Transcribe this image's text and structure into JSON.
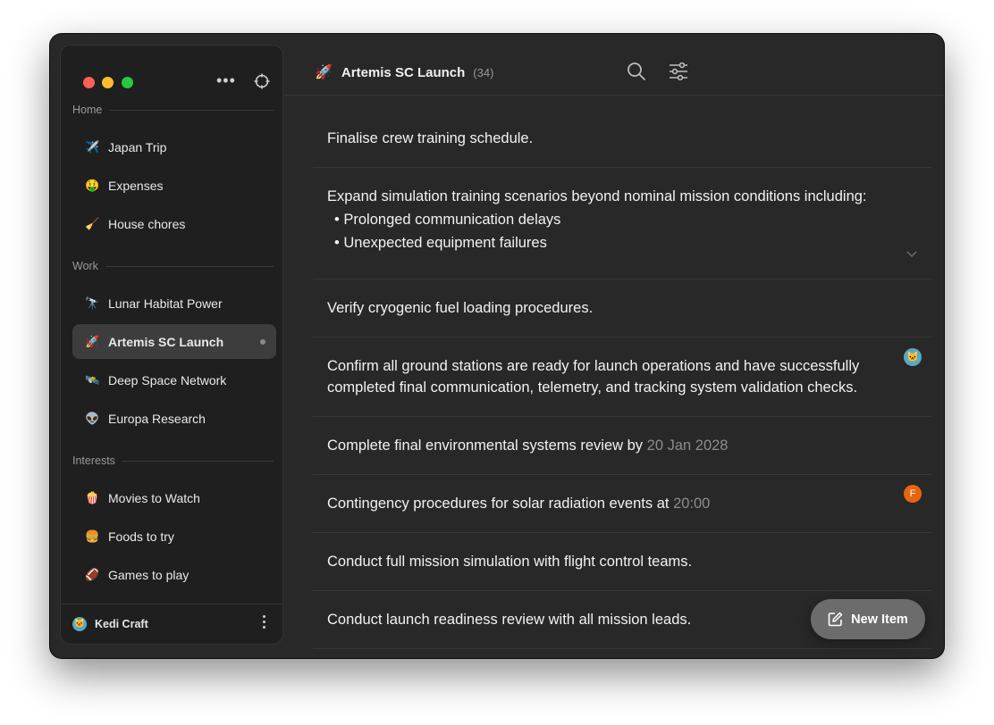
{
  "app": {
    "more_icon": "ellipsis-icon",
    "target_icon": "crosshair-icon"
  },
  "sidebar": {
    "sections": [
      {
        "label": "Home",
        "items": [
          {
            "emoji": "✈️",
            "label": "Japan Trip"
          },
          {
            "emoji": "🤑",
            "label": "Expenses"
          },
          {
            "emoji": "🧹",
            "label": "House chores"
          }
        ]
      },
      {
        "label": "Work",
        "items": [
          {
            "emoji": "🔭",
            "label": "Lunar Habitat Power"
          },
          {
            "emoji": "🚀",
            "label": "Artemis SC Launch",
            "active": true
          },
          {
            "emoji": "🛰️",
            "label": "Deep Space Network"
          },
          {
            "emoji": "👽",
            "label": "Europa Research"
          }
        ]
      },
      {
        "label": "Interests",
        "items": [
          {
            "emoji": "🍿",
            "label": "Movies to Watch"
          },
          {
            "emoji": "🍔",
            "label": "Foods to try"
          },
          {
            "emoji": "🏈",
            "label": "Games to play"
          }
        ]
      }
    ],
    "footer": {
      "avatar": "🐱",
      "name": "Kedi Craft"
    }
  },
  "header": {
    "emoji": "🚀",
    "title": "Artemis SC Launch",
    "count": "(34)",
    "search_icon": "search-icon",
    "filter_icon": "sliders-icon"
  },
  "items": [
    {
      "text": "Finalise crew training schedule."
    },
    {
      "text": "Expand simulation training scenarios beyond nominal mission conditions including:",
      "bullets": [
        "Prolonged communication delays",
        "Unexpected equipment failures"
      ]
    },
    {
      "text": "Verify cryogenic fuel loading procedures."
    },
    {
      "text": "Confirm all ground stations are ready for launch operations and have successfully",
      "text2": "completed final communication, telemetry, and tracking system validation checks.",
      "avatar": "🐱"
    },
    {
      "text": "Complete final environmental systems review by",
      "meta": "20 Jan 2028"
    },
    {
      "text": "Contingency procedures for solar radiation events at",
      "meta": "20:00",
      "avatar_letter": "F"
    },
    {
      "text": "Conduct full mission simulation with flight control teams."
    },
    {
      "text": "Conduct launch readiness review with all mission leads."
    }
  ],
  "new_item_button": {
    "label": "New Item",
    "icon": "compose-icon"
  },
  "colors": {
    "accent_orange": "#e8650f",
    "avatar_blue": "#5aa8c8"
  }
}
